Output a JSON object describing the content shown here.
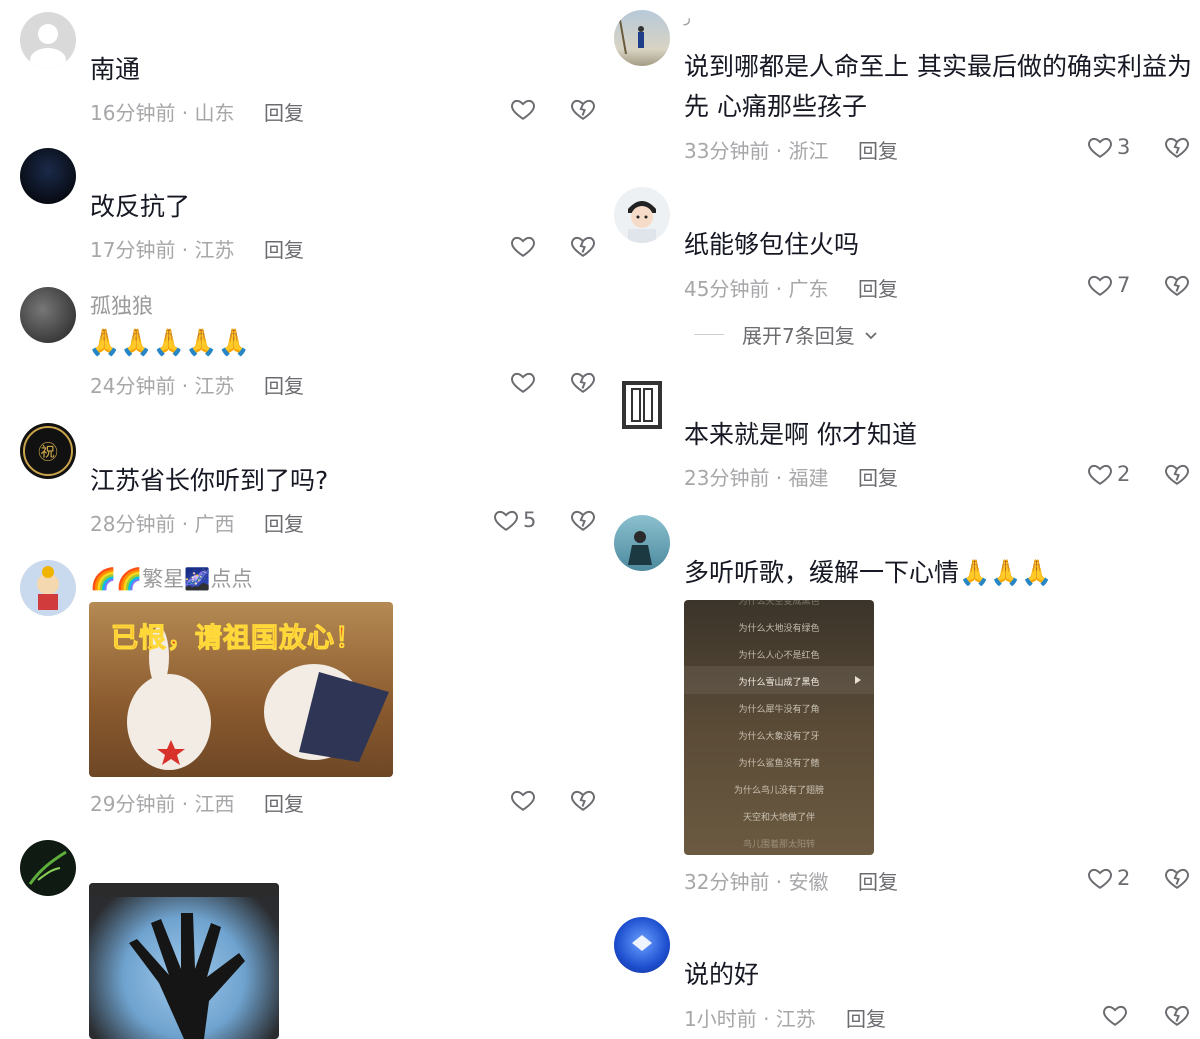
{
  "left": {
    "comments": [
      {
        "username": "",
        "text": "南通",
        "time": "16分钟前 · 山东",
        "reply": "回复",
        "likes": ""
      },
      {
        "username": "",
        "text": "改反抗了",
        "time": "17分钟前 · 江苏",
        "reply": "回复",
        "likes": ""
      },
      {
        "username": "孤独狼",
        "text": "🙏🙏🙏🙏🙏",
        "time": "24分钟前 · 江苏",
        "reply": "回复",
        "likes": ""
      },
      {
        "username": "",
        "text": "江苏省长你听到了吗?",
        "time": "28分钟前 · 广西",
        "reply": "回复",
        "likes": "5"
      },
      {
        "username": "🌈🌈繁星🌌点点",
        "text": "",
        "time": "29分钟前 · 江西",
        "reply": "回复",
        "likes": "",
        "image_caption": "已恨，请祖国放心！"
      },
      {
        "username": "",
        "text": "",
        "time": "",
        "reply": "",
        "likes": ""
      }
    ]
  },
  "right": {
    "comments": [
      {
        "username": "ر",
        "text": "说到哪都是人命至上 其实最后做的确实利益为先 心痛那些孩子",
        "time": "33分钟前 · 浙江",
        "reply": "回复",
        "likes": "3"
      },
      {
        "username": "",
        "text": "纸能够包住火吗",
        "time": "45分钟前 · 广东",
        "reply": "回复",
        "likes": "7",
        "expand": "展开7条回复"
      },
      {
        "username": "",
        "text": "本来就是啊  你才知道",
        "time": "23分钟前 · 福建",
        "reply": "回复",
        "likes": "2"
      },
      {
        "username": "",
        "text": "多听听歌，缓解一下心情🙏🙏🙏",
        "time": "32分钟前 · 安徽",
        "reply": "回复",
        "likes": "2",
        "lyrics": [
          "为什么天空变成黑色",
          "为什么大地没有绿色",
          "为什么人心不是红色",
          "为什么雪山成了黑色",
          "为什么犀牛没有了角",
          "为什么大象没有了牙",
          "为什么鲨鱼没有了鳍",
          "为什么鸟儿没有了翅膀",
          "天空和大地做了伴",
          "鸟儿围着那太阳转"
        ]
      },
      {
        "username": "",
        "text": "说的好",
        "time": "1小时前 · 江苏",
        "reply": "回复",
        "likes": ""
      }
    ]
  },
  "colors": {
    "text": "#161823",
    "meta": "#a7a7aa",
    "icon": "#6b6b70",
    "accent": "#fe2c55"
  },
  "icons": {
    "like": "heart-icon",
    "dislike": "broken-heart-icon",
    "expand": "chevron-down-icon"
  }
}
